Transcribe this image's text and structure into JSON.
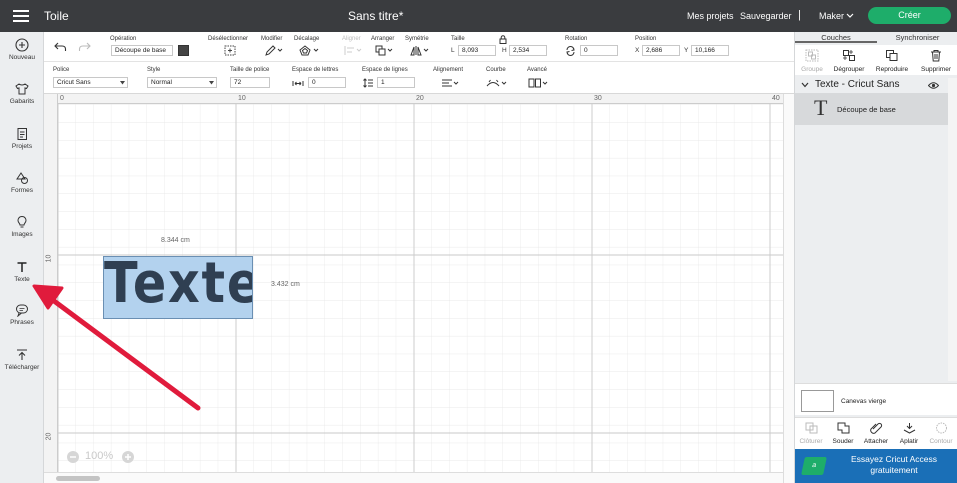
{
  "header": {
    "app_name": "Toile",
    "doc_title": "Sans titre*",
    "my_projects": "Mes projets",
    "save": "Sauvegarder",
    "separator": "|",
    "machine": "Maker",
    "create": "Créer"
  },
  "sidebar": {
    "items": [
      {
        "label": "Nouveau",
        "icon": "plus-circle-icon"
      },
      {
        "label": "Gabarits",
        "icon": "shirt-icon"
      },
      {
        "label": "Projets",
        "icon": "projects-icon"
      },
      {
        "label": "Formes",
        "icon": "shapes-icon"
      },
      {
        "label": "Images",
        "icon": "bulb-icon"
      },
      {
        "label": "Texte",
        "icon": "text-t-icon"
      },
      {
        "label": "Phrases",
        "icon": "speech-bubble-icon"
      },
      {
        "label": "Télécharger",
        "icon": "upload-icon"
      }
    ]
  },
  "toolbar1": {
    "operation_label": "Opération",
    "operation_value": "Découpe de base",
    "deselect": "Désélectionner",
    "modify": "Modifier",
    "offset": "Décalage",
    "align": "Aligner",
    "arrange": "Arranger",
    "symmetry": "Symétrie",
    "size_label": "Taille",
    "size_l_label": "L",
    "size_l": "8,093",
    "size_h_label": "H",
    "size_h": "2,534",
    "rotation_label": "Rotation",
    "rotation": "0",
    "position_label": "Position",
    "pos_x_label": "X",
    "pos_x": "2,686",
    "pos_y_label": "Y",
    "pos_y": "10,166"
  },
  "toolbar2": {
    "font_label": "Police",
    "font_value": "Cricut Sans",
    "style_label": "Style",
    "style_value": "Normal",
    "font_size_label": "Taille de police",
    "font_size": "72",
    "letter_spacing_label": "Espace de lettres",
    "letter_spacing": "0",
    "line_spacing_label": "Espace de lignes",
    "line_spacing": "1",
    "alignment_label": "Alignement",
    "curve_label": "Courbe",
    "advanced_label": "Avancé"
  },
  "ruler": {
    "top": [
      "0",
      "10",
      "20",
      "30",
      "40"
    ],
    "left": [
      "10",
      "20"
    ]
  },
  "canvas": {
    "width_dim": "8.344 cm",
    "height_dim": "3.432 cm",
    "text_object": "Texte",
    "zoom": "100%",
    "zoom_minus": "−",
    "zoom_plus": "+"
  },
  "right_panel": {
    "tab_layers": "Couches",
    "tab_sync": "Synchroniser",
    "tools": [
      {
        "label": "Groupe",
        "enabled": false
      },
      {
        "label": "Dégrouper",
        "enabled": true
      },
      {
        "label": "Reproduire",
        "enabled": true
      },
      {
        "label": "Supprimer",
        "enabled": true
      }
    ],
    "layer_group": "Texte - Cricut Sans",
    "layer_item": "Découpe de base",
    "layer_item_glyph": "T",
    "blank_canvas": "Canevas vierge",
    "bottom_tools": [
      {
        "label": "Clôturer",
        "enabled": false
      },
      {
        "label": "Souder",
        "enabled": true
      },
      {
        "label": "Attacher",
        "enabled": true
      },
      {
        "label": "Aplatir",
        "enabled": true
      },
      {
        "label": "Contour",
        "enabled": false
      }
    ],
    "promo": "Essayez Cricut Access gratuitement",
    "promo_badge": "a"
  },
  "colors": {
    "header_bg": "#3a3c3f",
    "create_btn": "#1ead6a",
    "selection_fill": "#b3d2ee",
    "text_fill": "#2f3f52",
    "annotation_arrow": "#e01b3c",
    "promo_bg": "#1a6fb7"
  }
}
